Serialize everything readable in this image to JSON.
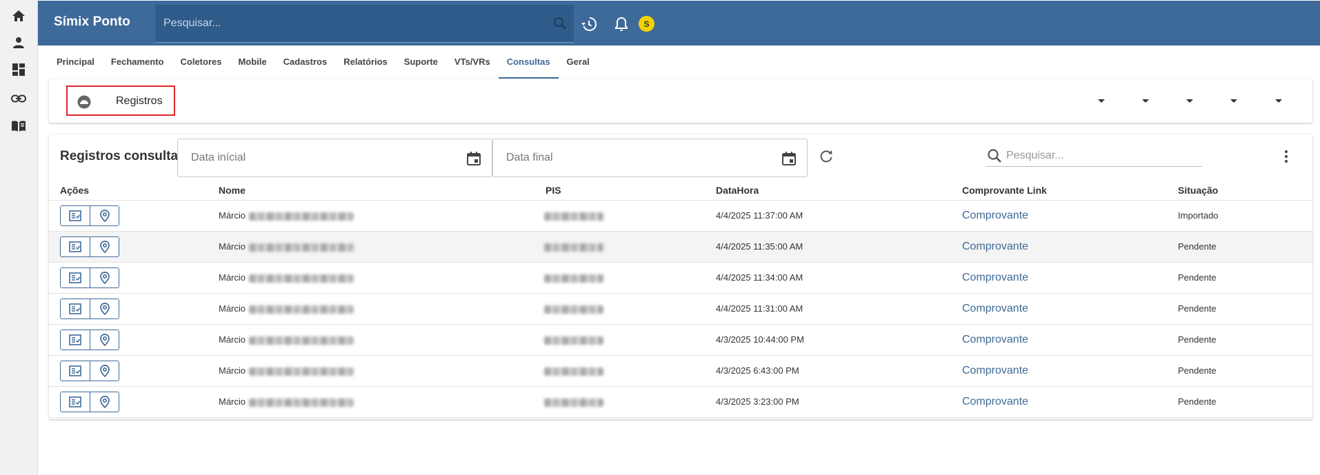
{
  "rail": {
    "items": [
      {
        "icon": "home-icon"
      },
      {
        "icon": "person-icon"
      },
      {
        "icon": "dashboard-icon"
      },
      {
        "icon": "link-icon"
      },
      {
        "icon": "book-icon"
      }
    ]
  },
  "header": {
    "brand": "Símix Ponto",
    "search_placeholder": "Pesquisar...",
    "avatar_initial": "S",
    "accent_color": "#3e6a99",
    "avatar_color": "#f3d200"
  },
  "nav": {
    "tabs": [
      "Principal",
      "Fechamento",
      "Coletores",
      "Mobile",
      "Cadastros",
      "Relatórios",
      "Suporte",
      "VTs/VRs",
      "Consultas",
      "Geral"
    ],
    "active": "Consultas"
  },
  "section": {
    "label": "Registros",
    "dropdown_count": 5,
    "highlight_color": "#e0262b"
  },
  "table_card": {
    "title": "Registros consulta",
    "date_start_placeholder": "Data inícial",
    "date_end_placeholder": "Data final",
    "search_placeholder": "Pesquisar..."
  },
  "table": {
    "headers": {
      "acoes": "Ações",
      "nome": "Nome",
      "pis": "PIS",
      "datahora": "DataHora",
      "comprovante": "Comprovante Link",
      "situacao": "Situação"
    },
    "rows": [
      {
        "nome": "Márcio",
        "datahora": "4/4/2025 11:37:00 AM",
        "comprovante": "Comprovante",
        "situacao": "Importado"
      },
      {
        "nome": "Márcio",
        "datahora": "4/4/2025 11:35:00 AM",
        "comprovante": "Comprovante",
        "situacao": "Pendente"
      },
      {
        "nome": "Márcio",
        "datahora": "4/4/2025 11:34:00 AM",
        "comprovante": "Comprovante",
        "situacao": "Pendente"
      },
      {
        "nome": "Márcio",
        "datahora": "4/4/2025 11:31:00 AM",
        "comprovante": "Comprovante",
        "situacao": "Pendente"
      },
      {
        "nome": "Márcio",
        "datahora": "4/3/2025 10:44:00 PM",
        "comprovante": "Comprovante",
        "situacao": "Pendente"
      },
      {
        "nome": "Márcio",
        "datahora": "4/3/2025 6:43:00 PM",
        "comprovante": "Comprovante",
        "situacao": "Pendente"
      },
      {
        "nome": "Márcio",
        "datahora": "4/3/2025 3:23:00 PM",
        "comprovante": "Comprovante",
        "situacao": "Pendente"
      }
    ]
  }
}
